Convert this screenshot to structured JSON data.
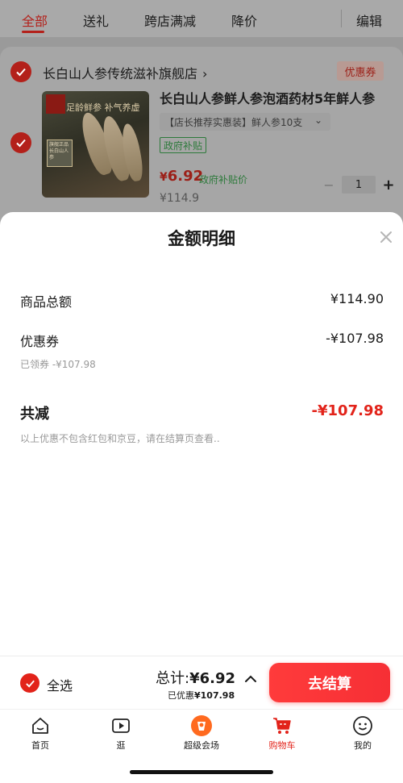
{
  "top_tabs": [
    "全部",
    "送礼",
    "跨店满减",
    "降价",
    "编辑"
  ],
  "shop": {
    "name": "长白山人参传统滋补旗舰店",
    "arrow": "›",
    "coupon_label": "优惠券"
  },
  "product": {
    "title": "长白山人参鲜人参泡酒药材5年鲜人参",
    "spec": "【店长推荐实惠装】鲜人参10支",
    "spec_chevron": "⌄",
    "gov_tag": "政府补贴",
    "price_symbol": "¥",
    "price_now": "6.92",
    "price_gov_label": "政府补贴价",
    "price_orig": "¥114.9",
    "quantity": "1",
    "minus": "−",
    "plus": "+",
    "image_text": "足龄鲜参 补气养虚",
    "image_badge": "旗舰正品 长白山人参"
  },
  "sheet": {
    "title": "金额明细",
    "goods_total_label": "商品总额",
    "goods_total_value": "¥114.90",
    "coupon_label": "优惠券",
    "coupon_value": "-¥107.98",
    "coupon_sub": "已领券 -¥107.98",
    "total_reduce_label": "共减",
    "total_reduce_value": "-¥107.98",
    "note": "以上优惠不包含红包和京豆，请在结算页查看.."
  },
  "checkout": {
    "select_all": "全选",
    "sum_prefix": "总计:",
    "sum_value": "¥6.92",
    "saved_prefix": "已优惠",
    "saved_value": "¥107.98",
    "button": "去结算"
  },
  "tab_bar": [
    {
      "label": "首页",
      "icon": "home-icon"
    },
    {
      "label": "逛",
      "icon": "play-icon"
    },
    {
      "label": "超级会场",
      "icon": "venue-icon"
    },
    {
      "label": "购物车",
      "icon": "cart-icon"
    },
    {
      "label": "我的",
      "icon": "smile-icon"
    }
  ],
  "colors": {
    "accent_red": "#e2231a",
    "gov_green": "#2d7a3b",
    "overlay_gray": "#9a9a9a"
  }
}
